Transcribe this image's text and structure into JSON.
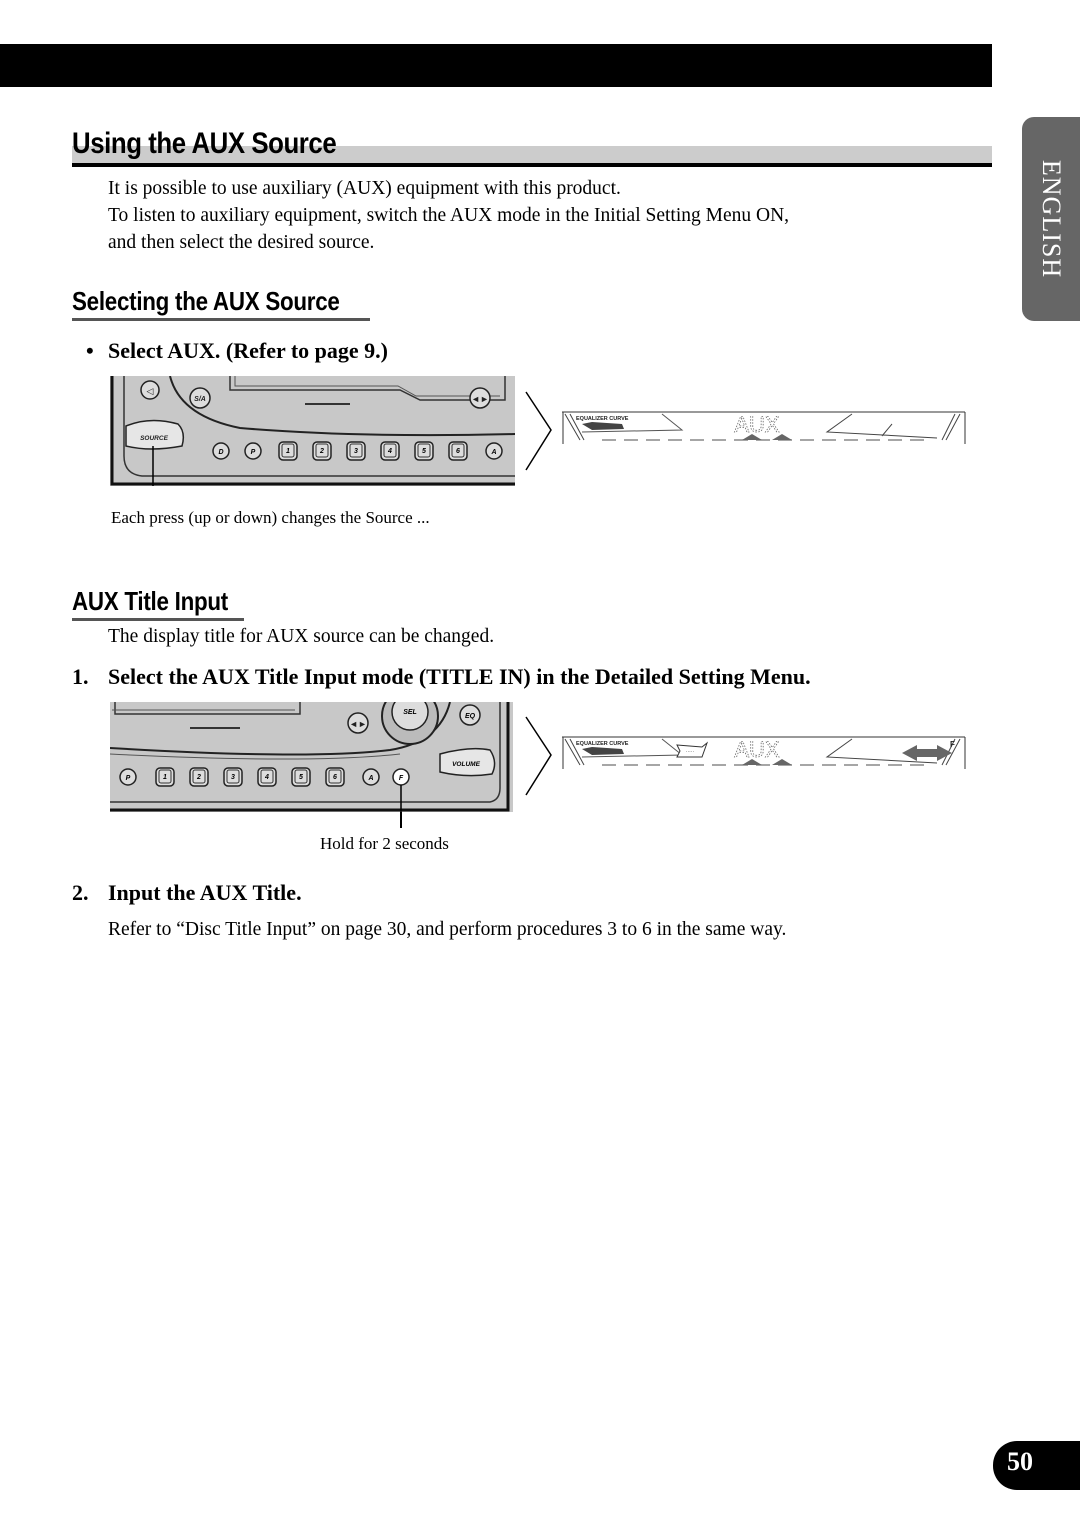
{
  "page": {
    "side_tab": "ENGLISH",
    "page_number": "50"
  },
  "section": {
    "title": "Using the AUX Source",
    "intro": [
      "It is possible to use auxiliary (AUX) equipment with this product.",
      "To listen to auxiliary equipment, switch the AUX mode in the Initial Setting Menu ON,",
      "and then select the desired source."
    ]
  },
  "selecting": {
    "title": "Selecting the AUX Source",
    "bullet": "•",
    "step": "Select AUX. (Refer to page 9.)",
    "figure": {
      "buttons": {
        "source": "SOURCE",
        "sa": "S/A",
        "d": "D",
        "p": "P",
        "presets": [
          "1",
          "2",
          "3",
          "4",
          "5",
          "6"
        ],
        "a": "A",
        "arrows": "◄►"
      },
      "display_label": "EQUALIZER CURVE",
      "display_text": "AUX",
      "caption": "Each press (up or down) changes the Source ..."
    }
  },
  "title_input": {
    "title": "AUX Title Input",
    "description": "The display title for AUX source can be changed.",
    "step1_num": "1.",
    "step1": "Select the AUX Title Input mode (TITLE IN) in the Detailed Setting Menu.",
    "figure": {
      "buttons": {
        "p": "P",
        "presets": [
          "1",
          "2",
          "3",
          "4",
          "5",
          "6"
        ],
        "a": "A",
        "f": "F",
        "sel": "SEL",
        "eq": "EQ",
        "volume": "VOLUME",
        "arrows": "◄►"
      },
      "display_label": "EQUALIZER CURVE",
      "display_text": "AUX",
      "display_f": "F",
      "caption": "Hold for 2 seconds"
    },
    "step2_num": "2.",
    "step2": "Input the AUX Title.",
    "step2_desc": "Refer to “Disc Title Input” on page 30, and perform procedures 3 to 6 in the same way."
  }
}
